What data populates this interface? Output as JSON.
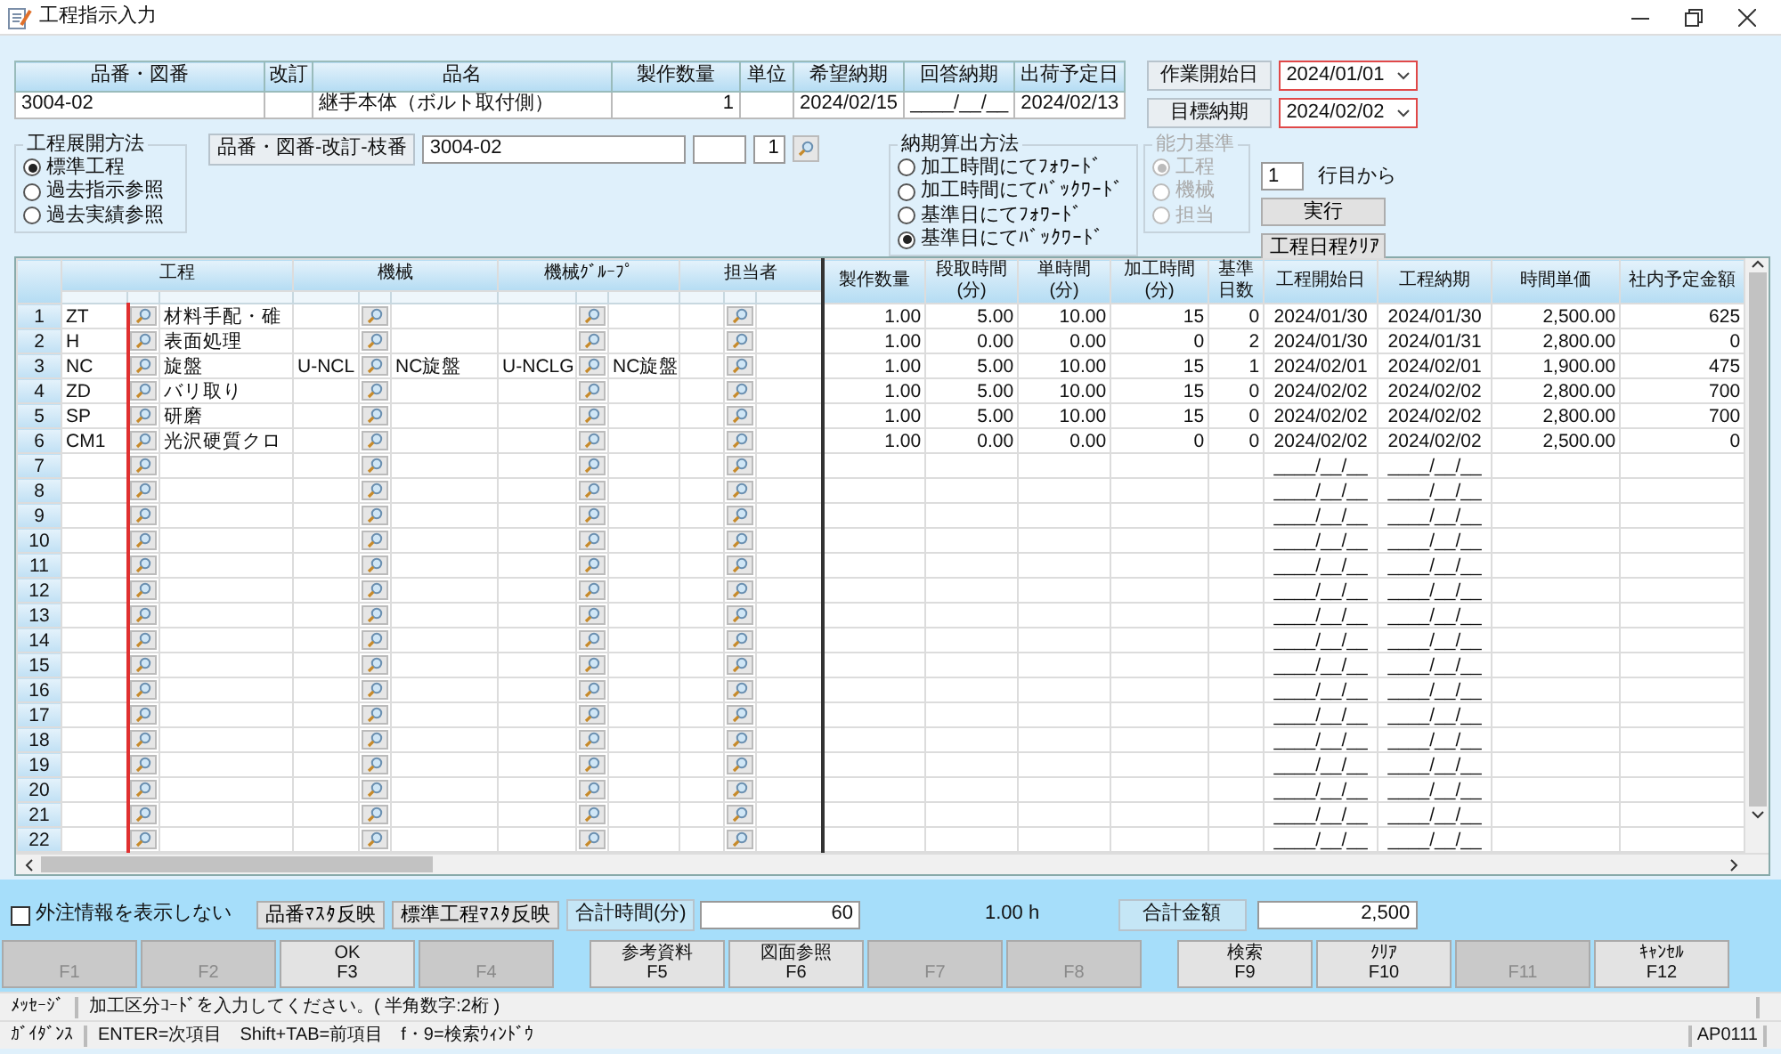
{
  "window": {
    "title": "工程指示入力"
  },
  "item_table": {
    "columns": [
      "品番・図番",
      "改訂",
      "品名",
      "製作数量",
      "単位",
      "希望納期",
      "回答納期",
      "出荷予定日"
    ],
    "row": {
      "part_no": "3004-02",
      "name": "継手本体（ボルト取付側）",
      "quantity": "1",
      "requested_due": "2024/02/15",
      "answered_due": "____/__/__",
      "ship_date": "2024/02/13"
    }
  },
  "dates": [
    {
      "label": "作業開始日",
      "value": "2024/01/01"
    },
    {
      "label": "目標納期",
      "value": "2024/02/02"
    }
  ],
  "expansion_method": {
    "title": "工程展開方法",
    "options": [
      {
        "label": "標準工程",
        "selected": true
      },
      {
        "label": "過去指示参照",
        "selected": false
      },
      {
        "label": "過去実績参照",
        "selected": false
      }
    ]
  },
  "part_lookup": {
    "label": "品番・図番-改訂-枝番",
    "part_no": "3004-02",
    "branch": "1"
  },
  "due_calc": {
    "title": "納期算出方法",
    "options": [
      {
        "label": "加工時間にてﾌｫﾜｰﾄﾞ",
        "selected": false
      },
      {
        "label": "加工時間にてﾊﾞｯｸﾜｰﾄﾞ",
        "selected": false
      },
      {
        "label": "基準日にてﾌｫﾜｰﾄﾞ",
        "selected": false
      },
      {
        "label": "基準日にてﾊﾞｯｸﾜｰﾄﾞ",
        "selected": true
      }
    ]
  },
  "capacity": {
    "title": "能力基準",
    "disabled": true,
    "options": [
      {
        "label": "工程",
        "selected": true
      },
      {
        "label": "機械",
        "selected": false
      },
      {
        "label": "担当",
        "selected": false
      }
    ]
  },
  "start_row": {
    "value": "1",
    "label": "行目から"
  },
  "buttons": [
    "実行",
    "工程日程ｸﾘｱ"
  ],
  "grid": {
    "group_headers": [
      "工程",
      "機械",
      "機械ｸﾞﾙｰﾌﾟ",
      "担当者"
    ],
    "columns": [
      {
        "label": "製作数量"
      },
      {
        "label": "段取時間",
        "unit": "(分)"
      },
      {
        "label": "単時間",
        "unit": "(分)"
      },
      {
        "label": "加工時間",
        "unit": "(分)"
      },
      {
        "label": "基準日数"
      },
      {
        "label": "工程開始日"
      },
      {
        "label": "工程納期"
      },
      {
        "label": "時間単価"
      },
      {
        "label": "社内予定金額"
      }
    ],
    "rows": [
      {
        "no": "1",
        "process_code": "ZT",
        "process_name": "材料手配・碓",
        "qty": "1.00",
        "setup": "5.00",
        "unit": "10.00",
        "proc": "15",
        "days": "0",
        "start": "2024/01/30",
        "due": "2024/01/30",
        "rate": "2,500.00",
        "amount": "625"
      },
      {
        "no": "2",
        "process_code": "H",
        "process_name": "表面処理",
        "qty": "1.00",
        "setup": "0.00",
        "unit": "0.00",
        "proc": "0",
        "days": "2",
        "start": "2024/01/30",
        "due": "2024/01/31",
        "rate": "2,800.00",
        "amount": "0"
      },
      {
        "no": "3",
        "process_code": "NC",
        "process_name": "旋盤",
        "machine_code": "U-NCL",
        "machine_name": "NC旋盤",
        "group_code": "U-NCLG",
        "group_name": "NC旋盤",
        "qty": "1.00",
        "setup": "5.00",
        "unit": "10.00",
        "proc": "15",
        "days": "1",
        "start": "2024/02/01",
        "due": "2024/02/01",
        "rate": "1,900.00",
        "amount": "475"
      },
      {
        "no": "4",
        "process_code": "ZD",
        "process_name": "バリ取り",
        "qty": "1.00",
        "setup": "5.00",
        "unit": "10.00",
        "proc": "15",
        "days": "0",
        "start": "2024/02/02",
        "due": "2024/02/02",
        "rate": "2,800.00",
        "amount": "700"
      },
      {
        "no": "5",
        "process_code": "SP",
        "process_name": "研磨",
        "qty": "1.00",
        "setup": "5.00",
        "unit": "10.00",
        "proc": "15",
        "days": "0",
        "start": "2024/02/02",
        "due": "2024/02/02",
        "rate": "2,800.00",
        "amount": "700"
      },
      {
        "no": "6",
        "process_code": "CM1",
        "process_name": "光沢硬質クロ",
        "qty": "1.00",
        "setup": "0.00",
        "unit": "0.00",
        "proc": "0",
        "days": "0",
        "start": "2024/02/02",
        "due": "2024/02/02",
        "rate": "2,500.00",
        "amount": "0"
      },
      {
        "no": "7",
        "start": "____/__/__",
        "due": "____/__/__"
      },
      {
        "no": "8",
        "start": "____/__/__",
        "due": "____/__/__"
      },
      {
        "no": "9",
        "start": "____/__/__",
        "due": "____/__/__"
      },
      {
        "no": "10",
        "start": "____/__/__",
        "due": "____/__/__"
      },
      {
        "no": "11",
        "start": "____/__/__",
        "due": "____/__/__"
      },
      {
        "no": "12",
        "start": "____/__/__",
        "due": "____/__/__"
      },
      {
        "no": "13",
        "start": "____/__/__",
        "due": "____/__/__"
      },
      {
        "no": "14",
        "start": "____/__/__",
        "due": "____/__/__"
      },
      {
        "no": "15",
        "start": "____/__/__",
        "due": "____/__/__"
      },
      {
        "no": "16",
        "start": "____/__/__",
        "due": "____/__/__"
      },
      {
        "no": "17",
        "start": "____/__/__",
        "due": "____/__/__"
      },
      {
        "no": "18",
        "start": "____/__/__",
        "due": "____/__/__"
      },
      {
        "no": "19",
        "start": "____/__/__",
        "due": "____/__/__"
      },
      {
        "no": "20",
        "start": "____/__/__",
        "due": "____/__/__"
      },
      {
        "no": "21",
        "start": "____/__/__",
        "due": "____/__/__"
      },
      {
        "no": "22",
        "start": "____/__/__",
        "due": "____/__/__"
      }
    ]
  },
  "external_toggle": {
    "label": "外注情報を表示しない",
    "checked": false
  },
  "master_buttons": [
    "品番ﾏｽﾀ反映",
    "標準工程ﾏｽﾀ反映"
  ],
  "total_time": {
    "label": "合計時間(分)",
    "value": "60",
    "hours": "1.00 h"
  },
  "total_amount": {
    "label": "合計金額",
    "value": "2,500"
  },
  "function_keys": [
    {
      "key": "F1",
      "disabled": true
    },
    {
      "key": "F2",
      "disabled": true
    },
    {
      "key": "F3",
      "label": "OK",
      "disabled": false
    },
    {
      "key": "F4",
      "disabled": true
    },
    {
      "key": "F5",
      "label": "参考資料",
      "disabled": false
    },
    {
      "key": "F6",
      "label": "図面参照",
      "disabled": false
    },
    {
      "key": "F7",
      "disabled": true
    },
    {
      "key": "F8",
      "disabled": true
    },
    {
      "key": "F9",
      "label": "検索",
      "disabled": false
    },
    {
      "key": "F10",
      "label": "ｸﾘｱ",
      "disabled": false
    },
    {
      "key": "F11",
      "disabled": true
    },
    {
      "key": "F12",
      "label": "ｷｬﾝｾﾙ",
      "disabled": false
    }
  ],
  "message": {
    "label": "ﾒｯｾｰｼﾞ",
    "text": "加工区分ｺｰﾄﾞを入力してください。( 半角数字:2桁 )"
  },
  "guidance": {
    "label": "ｶﾞｲﾀﾞﾝｽ",
    "text": "ENTER=次項目　Shift+TAB=前項目　f・9=検索ｳｨﾝﾄﾞｳ",
    "code": "AP0111"
  }
}
